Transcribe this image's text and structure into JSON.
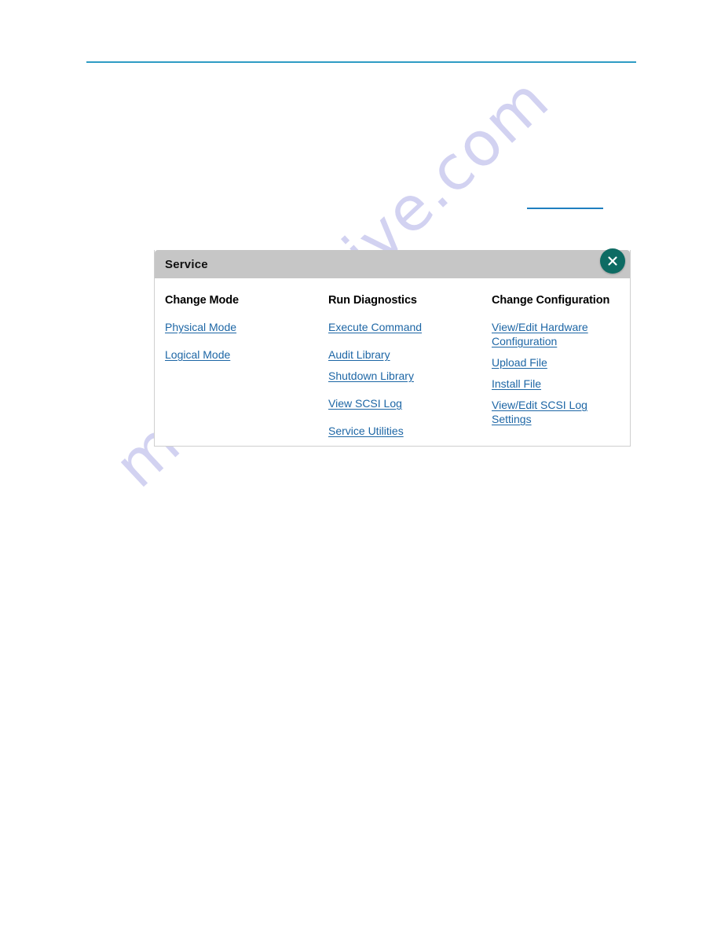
{
  "page": {
    "top_rule_color": "#2e9cc4",
    "watermark_text": "manualshive.com",
    "watermark_color": "#c6c6ee"
  },
  "dialog": {
    "title": "Service",
    "header_bg": "#c6c6c6",
    "close_button": {
      "icon": "close-x-icon",
      "label": "X",
      "color": "#0d6b63"
    },
    "link_color": "#1d66a5",
    "columns": [
      {
        "heading": "Change Mode",
        "links": [
          {
            "label": "Physical Mode",
            "gap": "first"
          },
          {
            "label": "Logical Mode",
            "gap": "gap-lg"
          }
        ]
      },
      {
        "heading": "Run Diagnostics",
        "links": [
          {
            "label": "Execute Command",
            "gap": "first"
          },
          {
            "label": "Audit Library",
            "gap": "gap-lg"
          },
          {
            "label": "Shutdown Library",
            "gap": "gap-sm"
          },
          {
            "label": "View SCSI Log",
            "gap": "gap-lg"
          },
          {
            "label": "Service Utilities",
            "gap": "gap-lg"
          }
        ]
      },
      {
        "heading": "Change Configuration",
        "links": [
          {
            "label": "View/Edit Hardware Configuration",
            "gap": "first"
          },
          {
            "label": "Upload File",
            "gap": "gap-md"
          },
          {
            "label": "Install File",
            "gap": "gap-sm"
          },
          {
            "label": "View/Edit SCSI Log Settings",
            "gap": "gap-md"
          }
        ]
      }
    ]
  }
}
